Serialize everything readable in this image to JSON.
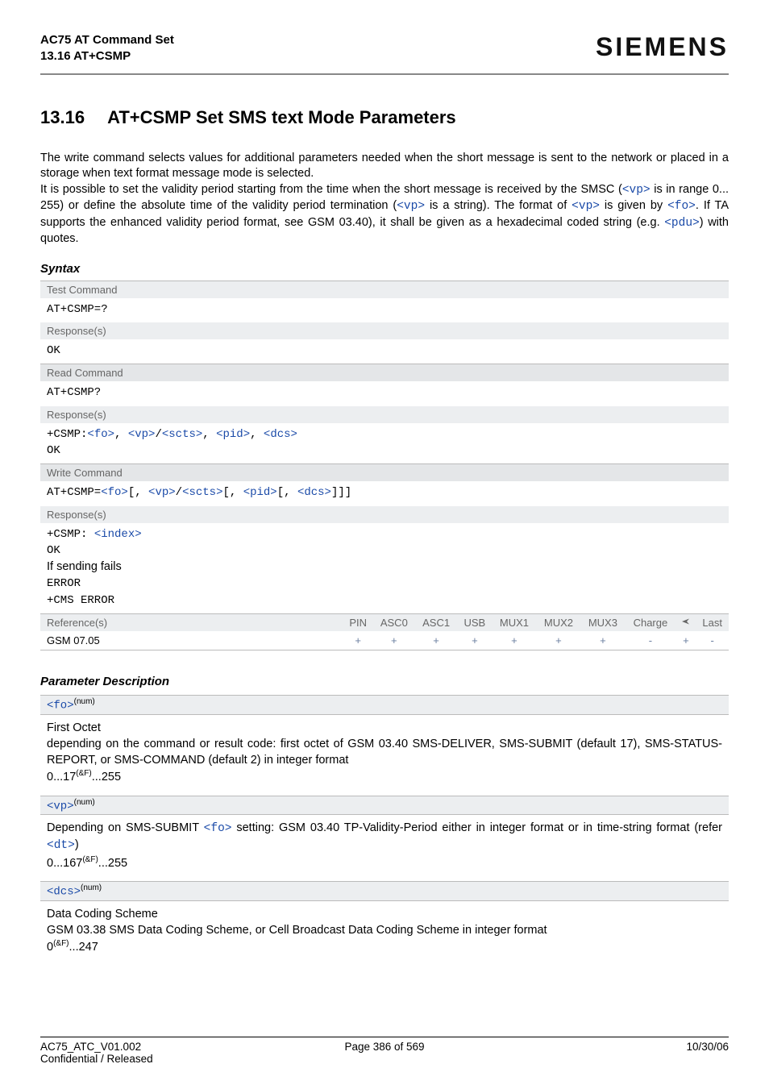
{
  "header": {
    "doc_title": "AC75 AT Command Set",
    "doc_sub": "13.16 AT+CSMP",
    "brand": "SIEMENS"
  },
  "section": {
    "number": "13.16",
    "title": "AT+CSMP   Set SMS text Mode Parameters"
  },
  "intro": {
    "p1a": "The write command selects values for additional parameters needed when the short message is sent to the network or placed in a storage when text format message mode is selected.",
    "p2_pre": "It is possible to set the validity period starting from the time when the short message is received by the SMSC (",
    "p2_vp1": "<vp>",
    "p2_mid1": " is in range 0... 255) or define the absolute time of the validity period termination (",
    "p2_vp2": "<vp>",
    "p2_mid2": " is a string). The format of ",
    "p2_vp3": "<vp>",
    "p2_mid3": " is given by ",
    "p2_fo": "<fo>",
    "p2_mid4": ". If TA supports the enhanced validity period format, see GSM 03.40), it shall be given as a hexadecimal coded string (e.g. ",
    "p2_pdu": "<pdu>",
    "p2_end": ") with quotes."
  },
  "syntax_label": "Syntax",
  "test_cmd": {
    "bar": "Test Command",
    "cmd": "AT+CSMP=?",
    "resp_bar": "Response(s)",
    "resp": "OK"
  },
  "read_cmd": {
    "bar": "Read Command",
    "cmd": "AT+CSMP?",
    "resp_bar": "Response(s)",
    "resp_prefix": "+CSMP:",
    "fo": "<fo>",
    "vp": "<vp>",
    "scts": "<scts>",
    "pid": "<pid>",
    "dcs": "<dcs>",
    "comma": ", ",
    "slash": "/",
    "ok": "OK"
  },
  "write_cmd": {
    "bar": "Write Command",
    "cmd_prefix": "AT+CSMP=",
    "fo": "<fo>",
    "vp": "<vp>",
    "scts": "<scts>",
    "pid": "<pid>",
    "dcs": "<dcs>",
    "lb": "[",
    "rb": "]",
    "rb3": "]]]",
    "comma": ", ",
    "slash": "/",
    "resp_bar": "Response(s)",
    "resp_prefix": "+CSMP: ",
    "index": "<index>",
    "ok": "OK",
    "fail": "If sending fails",
    "error": "ERROR",
    "cms": "+CMS ERROR"
  },
  "refs": {
    "head_ref": "Reference(s)",
    "cols": [
      "PIN",
      "ASC0",
      "ASC1",
      "USB",
      "MUX1",
      "MUX2",
      "MUX3",
      "Charge",
      "",
      "Last"
    ],
    "row_ref": "GSM 07.05",
    "row_vals": [
      "+",
      "+",
      "+",
      "+",
      "+",
      "+",
      "+",
      "-",
      "+",
      "-"
    ]
  },
  "param_label": "Parameter Description",
  "params": {
    "fo": {
      "tag": "<fo>",
      "sup": "(num)",
      "title": "First Octet",
      "body": "depending on the command or result code: first octet of GSM 03.40 SMS-DELIVER, SMS-SUBMIT (default 17), SMS-STATUS-REPORT, or SMS-COMMAND (default 2) in integer format",
      "range_a": "0...17",
      "range_sup": "(&F)",
      "range_b": "...255"
    },
    "vp": {
      "tag": "<vp>",
      "sup": "(num)",
      "body_a": "Depending on SMS-SUBMIT ",
      "fo": "<fo>",
      "body_b": " setting: GSM 03.40 TP-Validity-Period either in integer format or in time-string format (refer ",
      "dt": "<dt>",
      "body_c": ")",
      "range_a": "0...167",
      "range_sup": "(&F)",
      "range_b": "...255"
    },
    "dcs": {
      "tag": "<dcs>",
      "sup": "(num)",
      "title": "Data Coding Scheme",
      "body": "GSM 03.38 SMS Data Coding Scheme, or Cell Broadcast Data Coding Scheme in integer format",
      "range_a": "0",
      "range_sup": "(&F)",
      "range_b": "...247"
    }
  },
  "footer": {
    "left1": "AC75_ATC_V01.002",
    "left2": "Confidential / Released",
    "mid": "Page 386 of 569",
    "right": "10/30/06"
  }
}
